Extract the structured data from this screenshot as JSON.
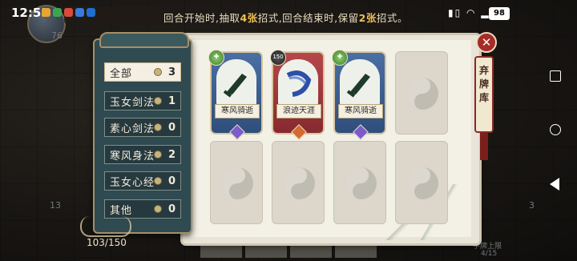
{
  "status_bar": {
    "time": "12:55",
    "battery": "98"
  },
  "hint": {
    "pre": "回合开始时,抽取",
    "draw_count": "4张",
    "mid": "招式,回合结束时,保留",
    "keep_count": "2张",
    "post": "招式。"
  },
  "hud": {
    "level": "76",
    "hp": "103/150",
    "left_counter": "13",
    "right_counter": "3",
    "pile_label": "手牌上限",
    "pile_count": "4/15"
  },
  "filter": {
    "items": [
      {
        "label": "全部",
        "count": "3",
        "active": true
      },
      {
        "label": "玉女剑法",
        "count": "1"
      },
      {
        "label": "素心剑法",
        "count": "0"
      },
      {
        "label": "寒风身法",
        "count": "2"
      },
      {
        "label": "玉女心经",
        "count": "0"
      },
      {
        "label": "其他",
        "count": "0"
      }
    ]
  },
  "cards": [
    {
      "name": "寒风骑逝",
      "cost": "",
      "theme": "blue"
    },
    {
      "name": "浪迹天涯",
      "cost": "150",
      "theme": "red"
    },
    {
      "name": "寒风骑逝",
      "cost": "",
      "theme": "blue"
    }
  ],
  "discard_tab": {
    "label": "弃牌库"
  },
  "close_icon": "close-icon",
  "colors": {
    "accent": "#f2c14e",
    "panel": "#2f4a50",
    "card_blue": "#4a6fa3",
    "card_red": "#b6474a"
  }
}
